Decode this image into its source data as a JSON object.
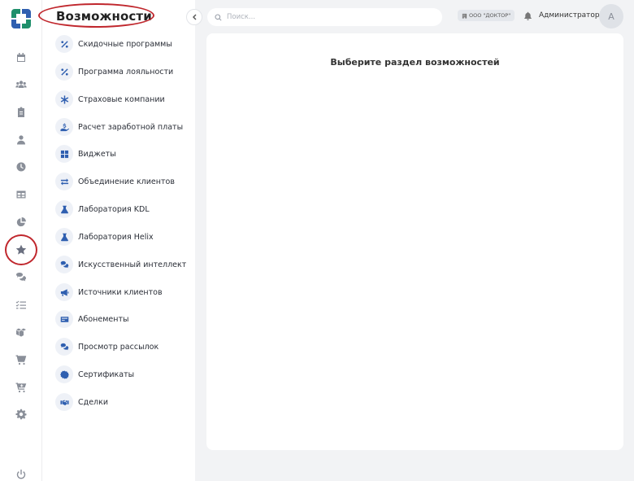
{
  "sidebar": {
    "title": "Возможности",
    "items": [
      {
        "label": "Скидочные программы",
        "icon": "percent-icon"
      },
      {
        "label": "Программа лояльности",
        "icon": "percent-icon"
      },
      {
        "label": "Страховые компании",
        "icon": "asterisk-icon"
      },
      {
        "label": "Расчет заработной платы",
        "icon": "salary-hand-icon"
      },
      {
        "label": "Виджеты",
        "icon": "widgets-grid-icon"
      },
      {
        "label": "Объединение клиентов",
        "icon": "merge-arrows-icon"
      },
      {
        "label": "Лаборатория KDL",
        "icon": "flask-icon"
      },
      {
        "label": "Лаборатория Helix",
        "icon": "flask-icon"
      },
      {
        "label": "Искусственный интеллект",
        "icon": "chat-bubbles-icon"
      },
      {
        "label": "Источники клиентов",
        "icon": "megaphone-icon"
      },
      {
        "label": "Абонементы",
        "icon": "ticket-card-icon"
      },
      {
        "label": "Просмотр рассылок",
        "icon": "chat-bubbles-icon"
      },
      {
        "label": "Сертификаты",
        "icon": "certificate-badge-icon"
      },
      {
        "label": "Сделки",
        "icon": "handshake-icon"
      }
    ]
  },
  "rail": {
    "items": [
      "calendar-icon",
      "users-icon",
      "clipboard-icon",
      "user-icon",
      "clock-icon",
      "table-icon",
      "pie-chart-icon",
      "star-icon",
      "chat-icon",
      "checklist-icon",
      "boxes-icon",
      "cart-icon",
      "cart-plus-icon",
      "gear-icon",
      "power-icon"
    ],
    "active": "star-icon"
  },
  "header": {
    "search_placeholder": "Поиск...",
    "org": "ООО \"ДОКТОР\"",
    "user_name": "Администратор",
    "avatar_letter": "А"
  },
  "main": {
    "title": "Выберите раздел возможностей"
  },
  "colors": {
    "accent": "#2f5fb0",
    "highlight_circle": "#c0272d",
    "background": "#f2f3f5"
  }
}
